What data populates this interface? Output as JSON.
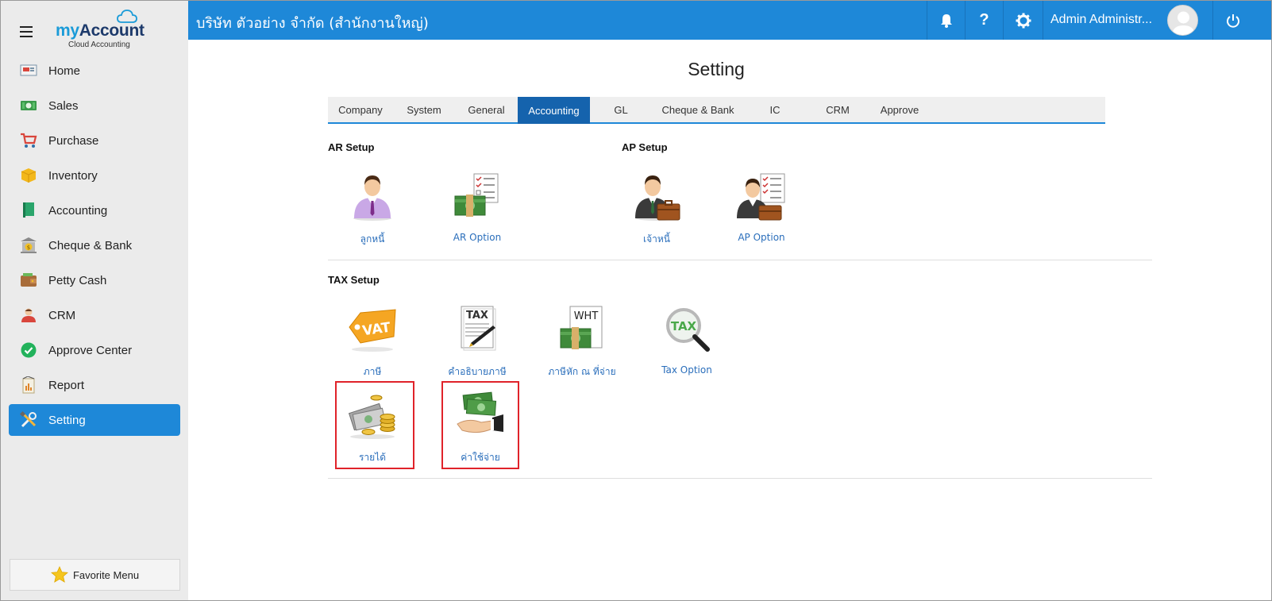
{
  "app": {
    "logo_my": "my",
    "logo_account": "Account",
    "logo_sub": "Cloud Accounting"
  },
  "sidebar": {
    "items": [
      {
        "label": "Home",
        "icon": "home-icon"
      },
      {
        "label": "Sales",
        "icon": "sales-icon"
      },
      {
        "label": "Purchase",
        "icon": "cart-icon"
      },
      {
        "label": "Inventory",
        "icon": "box-icon"
      },
      {
        "label": "Accounting",
        "icon": "book-icon"
      },
      {
        "label": "Cheque & Bank",
        "icon": "bank-icon"
      },
      {
        "label": "Petty Cash",
        "icon": "wallet-icon"
      },
      {
        "label": "CRM",
        "icon": "crm-icon"
      },
      {
        "label": "Approve Center",
        "icon": "check-circle-icon"
      },
      {
        "label": "Report",
        "icon": "report-icon"
      },
      {
        "label": "Setting",
        "icon": "tools-icon",
        "active": true
      }
    ],
    "favorite_label": "Favorite Menu"
  },
  "header": {
    "company": "บริษัท ตัวอย่าง จำกัด (สำนักงานใหญ่)",
    "user": "Admin Administr...",
    "accent": "#1e88d8"
  },
  "main": {
    "title": "Setting",
    "tabs": [
      {
        "label": "Company"
      },
      {
        "label": "System"
      },
      {
        "label": "General"
      },
      {
        "label": "Accounting",
        "active": true
      },
      {
        "label": "GL"
      },
      {
        "label": "Cheque & Bank"
      },
      {
        "label": "IC"
      },
      {
        "label": "CRM"
      },
      {
        "label": "Approve"
      }
    ],
    "ar_setup": {
      "title": "AR Setup",
      "items": [
        {
          "label": "ลูกหนี้",
          "icon": "customer-icon"
        },
        {
          "label": "AR Option",
          "icon": "ar-option-icon"
        }
      ]
    },
    "ap_setup": {
      "title": "AP Setup",
      "items": [
        {
          "label": "เจ้าหนี้",
          "icon": "vendor-icon"
        },
        {
          "label": "AP Option",
          "icon": "ap-option-icon"
        }
      ]
    },
    "tax_setup": {
      "title": "TAX Setup",
      "items": [
        {
          "label": "ภาษี",
          "icon": "vat-tag-icon",
          "icon_text": "VAT"
        },
        {
          "label": "คำอธิบายภาษี",
          "icon": "tax-document-icon",
          "icon_text": "TAX"
        },
        {
          "label": "ภาษีหัก ณ ที่จ่าย",
          "icon": "wht-icon",
          "icon_text": "WHT"
        },
        {
          "label": "Tax Option",
          "icon": "tax-magnifier-icon",
          "icon_text": "TAX"
        },
        {
          "label": "รายได้",
          "icon": "income-money-icon",
          "highlighted": true
        },
        {
          "label": "ค่าใช้จ่าย",
          "icon": "expense-hand-icon",
          "highlighted": true
        }
      ]
    },
    "highlight_color": "#e0232a"
  }
}
